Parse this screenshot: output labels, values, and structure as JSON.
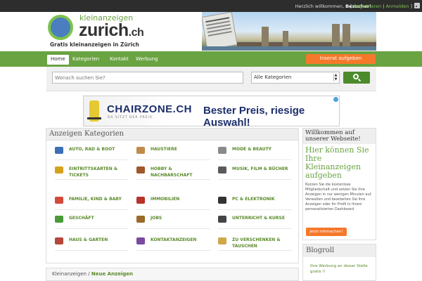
{
  "topbar": {
    "welcome": "Herzlich willkommen, ",
    "visitor": "Besucher!",
    "bracket_open": " [ ",
    "register": "Registrieren",
    "sep": " | ",
    "login": "Anmelden",
    "bracket_close": " ]"
  },
  "logo": {
    "small": "kleinanzeigen",
    "big": "zurich",
    "tld": ".ch",
    "subtitle": "Gratis kleinanzeigen in Zürich"
  },
  "nav": {
    "items": [
      "Home",
      "Kategorien",
      "Kontakt",
      "Werbung"
    ],
    "insert": "Inserat aufgeben"
  },
  "search": {
    "placeholder": "Wonach suchen Sie?",
    "category": "Alle Kategorien",
    "arrow_up": "▲",
    "arrow_down": "▼"
  },
  "banner": {
    "brand": "CHAIRZONE.CH",
    "brand_sub": "DA SITZT DER PREIS",
    "claim": "Bester Preis, riesige Auswahl!"
  },
  "categories": {
    "title": "Anzeigen Kategorien",
    "items": [
      {
        "label": "AUTO, RAD & BOOT",
        "icon": "car-icon",
        "color": "#3b6fb6"
      },
      {
        "label": "HAUSTIERE",
        "icon": "pet-icon",
        "color": "#c28a4a"
      },
      {
        "label": "MODE & BEAUTY",
        "icon": "fashion-icon",
        "color": "#8a8a8a"
      },
      {
        "label": "EINTRITTSKARTEN & TICKETS",
        "icon": "ticket-icon",
        "color": "#d6a21e"
      },
      {
        "label": "HOBBY & NACHBARSCHAFT",
        "icon": "guitar-icon",
        "color": "#a0572a"
      },
      {
        "label": "MUSIK, FILM & BÜCHER",
        "icon": "music-icon",
        "color": "#5a5a5a"
      },
      {
        "label": "FAMILIE, KIND & BABY",
        "icon": "family-icon",
        "color": "#d24a3a"
      },
      {
        "label": "IMMOBILIEN",
        "icon": "house-icon",
        "color": "#b8322a"
      },
      {
        "label": "PC & ELEKTRONIK",
        "icon": "computer-icon",
        "color": "#333333"
      },
      {
        "label": "GESCHÄFT",
        "icon": "cash-icon",
        "color": "#4a9a3a"
      },
      {
        "label": "JOBS",
        "icon": "briefcase-icon",
        "color": "#9a6a2a"
      },
      {
        "label": "UNTERRICHT & KURSE",
        "icon": "education-icon",
        "color": "#444444"
      },
      {
        "label": "HAUS & GARTEN",
        "icon": "furniture-icon",
        "color": "#b5483a"
      },
      {
        "label": "KONTAKTANZEIGEN",
        "icon": "contact-icon",
        "color": "#7a4aa0"
      },
      {
        "label": "ZU VERSCHENKEN & TAUSCHEN",
        "icon": "gift-icon",
        "color": "#cfa84a"
      }
    ]
  },
  "welcome_box": {
    "title": "Willkommen auf unserer Webseite!",
    "headline": "Hier können Sie Ihre Kleinanzeigen aufgeben",
    "text": "Nutzen Sie die kostenlose Mitgliedschaft und setzen Sie Ihre Anzeigen in nur wenigen Minuten auf. Verwalten und bearbeiten Sie Ihre Anzeigen oder Ihr Profil in Ihrem personalisierten Dashboard.",
    "button": "Jetzt mitmachen!"
  },
  "blogroll": {
    "title": "Blogroll",
    "link": "Ihre Werbung an dieser Stelle gratis !!"
  },
  "breadcrumb": {
    "home": "Kleinanzeigen",
    "sep": " / ",
    "current": "Neue Anzeigen"
  }
}
